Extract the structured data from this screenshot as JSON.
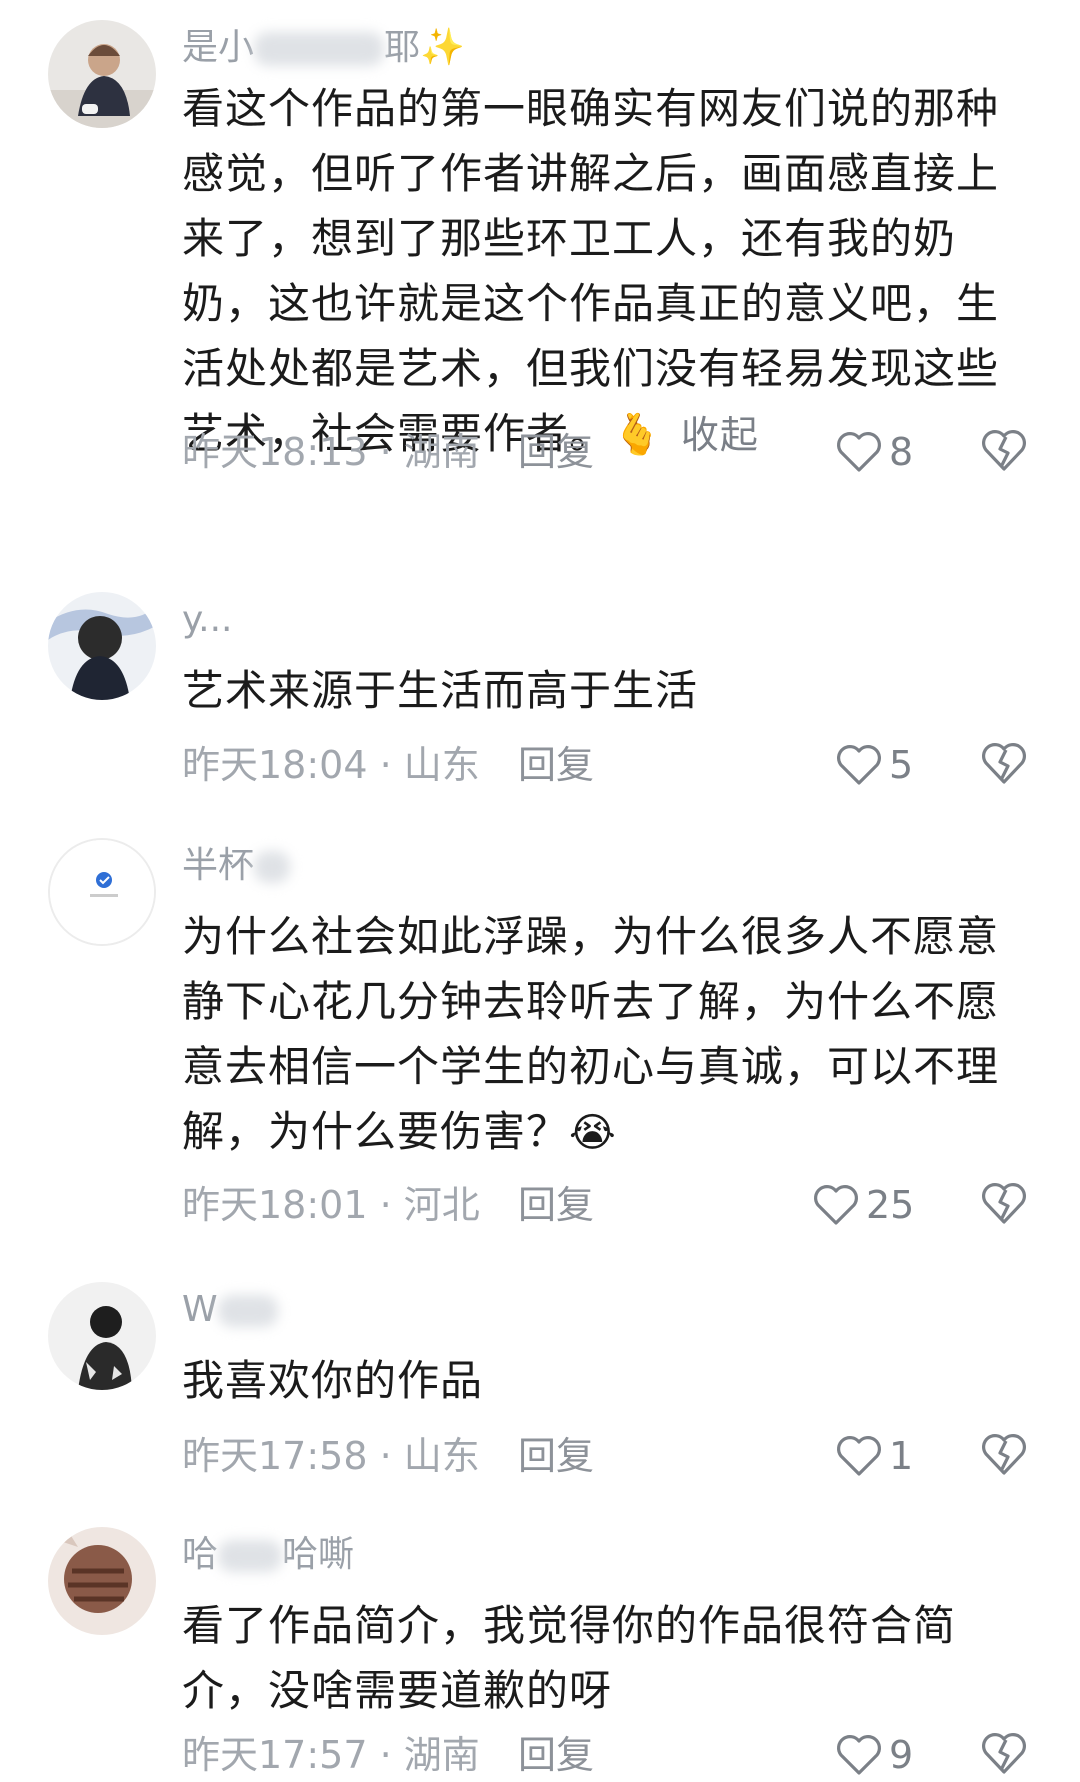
{
  "comments": [
    {
      "username_visible_start": "是小",
      "username_visible_end": "耶",
      "username_emoji": "✨",
      "text": "看这个作品的第一眼确实有网友们说的那种感觉，但听了作者讲解之后，画面感直接上来了，想到了那些环卫工人，还有我的奶奶，这也许就是这个作品真正的意义吧，生活处处都是艺术，但我们没有轻易发现这些艺术，社会需要作者。",
      "emoji": "🫰",
      "collapse_label": "收起",
      "time": "昨天18:13",
      "region": "湖南",
      "reply_label": "回复",
      "likes": "8"
    },
    {
      "username": "y...",
      "text": "艺术来源于生活而高于生活",
      "time": "昨天18:04",
      "region": "山东",
      "reply_label": "回复",
      "likes": "5"
    },
    {
      "username_visible_start": "半杯",
      "text": "为什么社会如此浮躁，为什么很多人不愿意静下心花几分钟去聆听去了解，为什么不愿意去相信一个学生的初心与真诚，可以不理解，为什么要伤害？",
      "emoji": "😭",
      "time": "昨天18:01",
      "region": "河北",
      "reply_label": "回复",
      "likes": "25"
    },
    {
      "username_visible_start": "W",
      "text": "我喜欢你的作品",
      "time": "昨天17:58",
      "region": "山东",
      "reply_label": "回复",
      "likes": "1"
    },
    {
      "username_visible_start": "哈",
      "username_visible_end": "哈嘶",
      "text": "看了作品简介，我觉得你的作品很符合简介，没啥需要道歉的呀",
      "time": "昨天17:57",
      "region": "湖南",
      "reply_label": "回复",
      "likes": "9"
    }
  ],
  "meta_separator": " · ",
  "colors": {
    "text": "#1b1b1b",
    "secondary": "#a2a7ae",
    "icon": "#7b8087",
    "background": "#ffffff"
  },
  "icons": {
    "like": "heart-outline-icon",
    "dislike": "broken-heart-outline-icon"
  }
}
